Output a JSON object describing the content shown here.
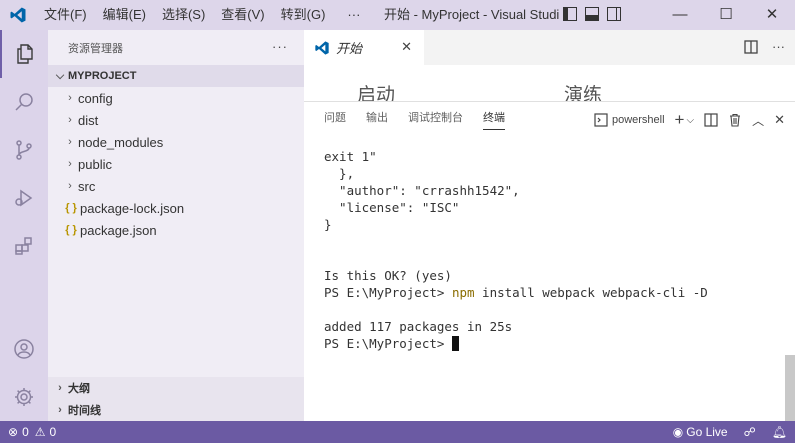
{
  "titlebar": {
    "menu": [
      "文件(F)",
      "编辑(E)",
      "选择(S)",
      "查看(V)",
      "转到(G)",
      "···"
    ],
    "title": "开始 - MyProject - Visual Studi…",
    "window_controls": {
      "minimize": "—",
      "maximize": "☐",
      "close": "✕"
    }
  },
  "activity_bar": {
    "icons": [
      "files-icon",
      "search-icon",
      "source-control-icon",
      "run-debug-icon",
      "extensions-icon",
      "account-icon",
      "settings-gear-icon"
    ]
  },
  "sidebar": {
    "header": "资源管理器",
    "more": "···",
    "project": "MYPROJECT",
    "tree": [
      {
        "label": "config",
        "type": "folder"
      },
      {
        "label": "dist",
        "type": "folder"
      },
      {
        "label": "node_modules",
        "type": "folder"
      },
      {
        "label": "public",
        "type": "folder"
      },
      {
        "label": "src",
        "type": "folder"
      },
      {
        "label": "package-lock.json",
        "type": "json",
        "icon": "{ }"
      },
      {
        "label": "package.json",
        "type": "json",
        "icon": "{ }"
      }
    ],
    "sections": [
      "大纲",
      "时间线"
    ]
  },
  "editor": {
    "tab": {
      "label": "开始",
      "close": "✕"
    },
    "welcome_headings": [
      "启动",
      "演练"
    ]
  },
  "panel": {
    "tabs": [
      "问题",
      "输出",
      "调试控制台",
      "终端"
    ],
    "active_tab": "终端",
    "shell": "powershell",
    "terminal": {
      "lines": [
        "exit 1\"",
        "  },",
        "  \"author\": \"crrashh1542\",",
        "  \"license\": \"ISC\"",
        "}",
        "",
        "",
        "Is this OK? (yes)"
      ],
      "cmd_prompt": "PS E:\\MyProject> ",
      "cmd_keyword": "npm",
      "cmd_rest": " install webpack webpack-cli -D",
      "result": "added 117 packages in 25s",
      "final_prompt": "PS E:\\MyProject> "
    }
  },
  "statusbar": {
    "errors": "0",
    "warnings": "0",
    "go_live": "Go Live"
  },
  "colors": {
    "titlebar": "#ddd6ea",
    "activity_bar": "#dcd4ea",
    "sidebar": "#f0edf5",
    "statusbar": "#6b5aa3",
    "vscode_blue": "#0065a9"
  }
}
